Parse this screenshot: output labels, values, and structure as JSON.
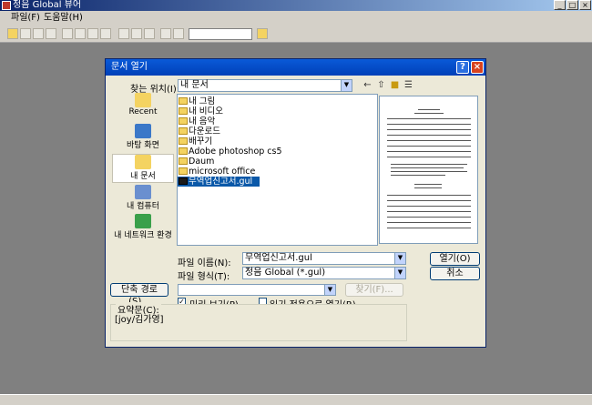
{
  "app": {
    "title": "정음 Global 뷰어"
  },
  "menu": {
    "file": "파일(F)",
    "help": "도움말(H)"
  },
  "dialog": {
    "title": "문서 열기",
    "lookin_label": "찾는 위치(I):",
    "lookin_value": "내 문서",
    "places": [
      "Recent",
      "바탕 화면",
      "내 문서",
      "내 컴퓨터",
      "내 네트워크 환경"
    ],
    "files": [
      "내 그림",
      "내 비디오",
      "내 음악",
      "다운로드",
      "배꾸기",
      "Adobe photoshop cs5",
      "Daum",
      "microsoft office",
      "무역업신고서.gul"
    ],
    "filename_label": "파일 이름(N):",
    "filename_value": "무역업신고서.gul",
    "filetype_label": "파일 형식(T):",
    "filetype_value": "정음 Global (*.gul)",
    "open_button": "열기(O)",
    "cancel_button": "취소",
    "shortcut_button": "단축 경로(S)...",
    "find_button": "찾기(F)...",
    "preview_label": "미리 보기(P)",
    "readonly_label": "읽기 전용으로 열기(R)",
    "summary_label": "요약문(C):",
    "summary_value": "[joy/김가영]"
  },
  "colors": {
    "titlebar": "#0a246a",
    "dialog_title": "#0a5ad8",
    "selection": "#0a58a8"
  }
}
